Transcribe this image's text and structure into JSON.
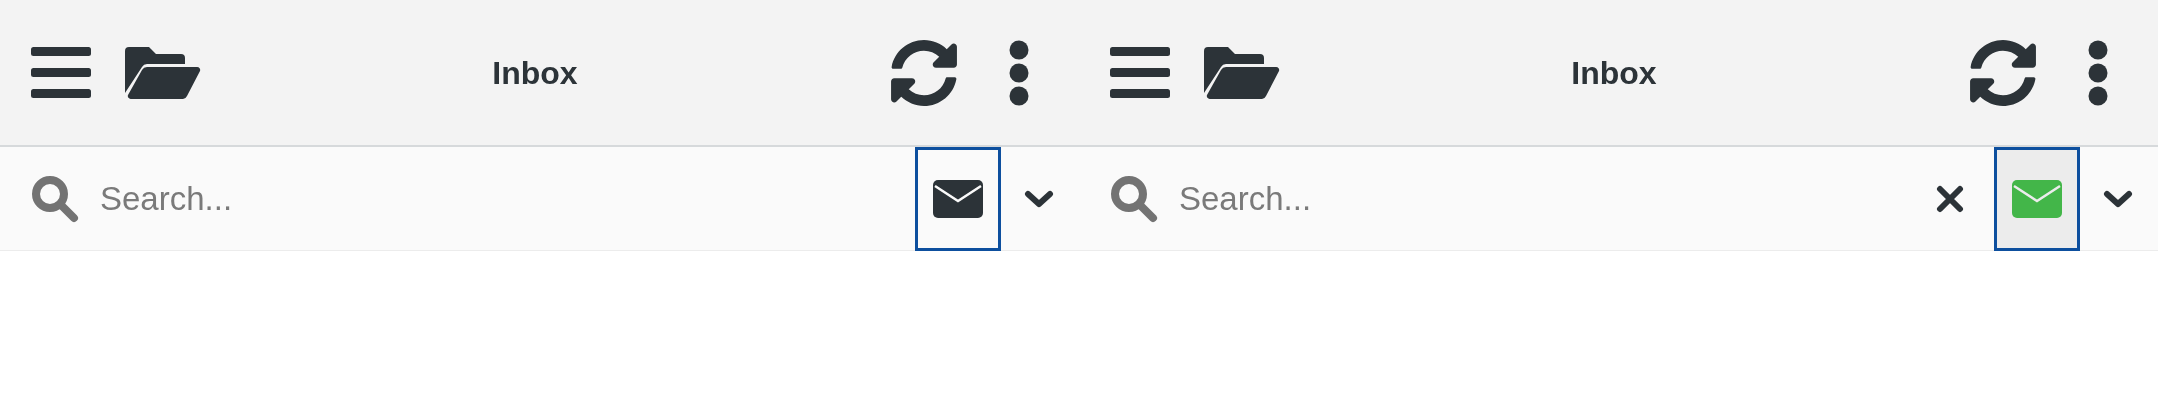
{
  "panels": [
    {
      "title": "Inbox",
      "search": {
        "placeholder": "Search...",
        "clear_visible": false
      },
      "unread_filter": {
        "selected": false
      }
    },
    {
      "title": "Inbox",
      "search": {
        "placeholder": "Search...",
        "clear_visible": true
      },
      "unread_filter": {
        "selected": true
      }
    }
  ]
}
